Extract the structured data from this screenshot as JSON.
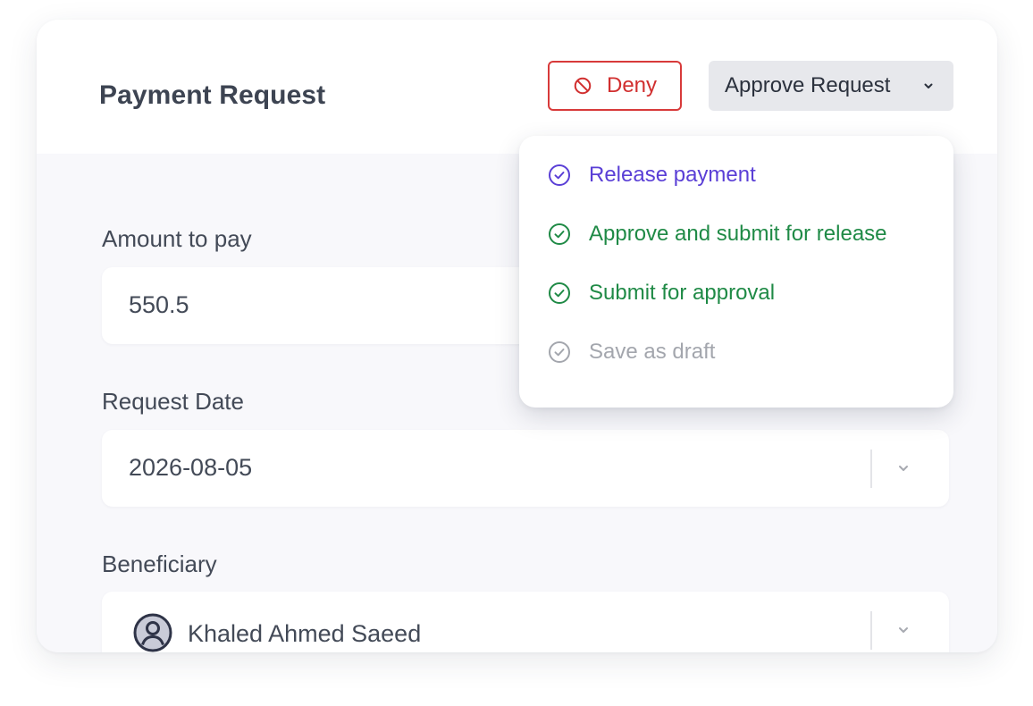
{
  "header": {
    "title": "Payment Request",
    "deny_label": "Deny",
    "approve_label": "Approve Request"
  },
  "dropdown": {
    "items": [
      {
        "label": "Release payment",
        "color": "#5a3fd6",
        "icon": "check-circle-icon"
      },
      {
        "label": "Approve and submit for release",
        "color": "#1f8a46",
        "icon": "check-circle-icon"
      },
      {
        "label": "Submit for approval",
        "color": "#1f8a46",
        "icon": "check-circle-icon"
      },
      {
        "label": "Save as draft",
        "color": "#a3a6ad",
        "icon": "check-circle-icon"
      }
    ]
  },
  "form": {
    "amount": {
      "label": "Amount to pay",
      "value": "550.5"
    },
    "request_date": {
      "label": "Request Date",
      "value": "2026-08-05"
    },
    "beneficiary": {
      "label": "Beneficiary",
      "value": "Khaled Ahmed Saeed"
    }
  },
  "colors": {
    "deny": "#d12f2f",
    "approve_bg": "#e7e8ec",
    "card_bg": "#f8f8fb"
  }
}
